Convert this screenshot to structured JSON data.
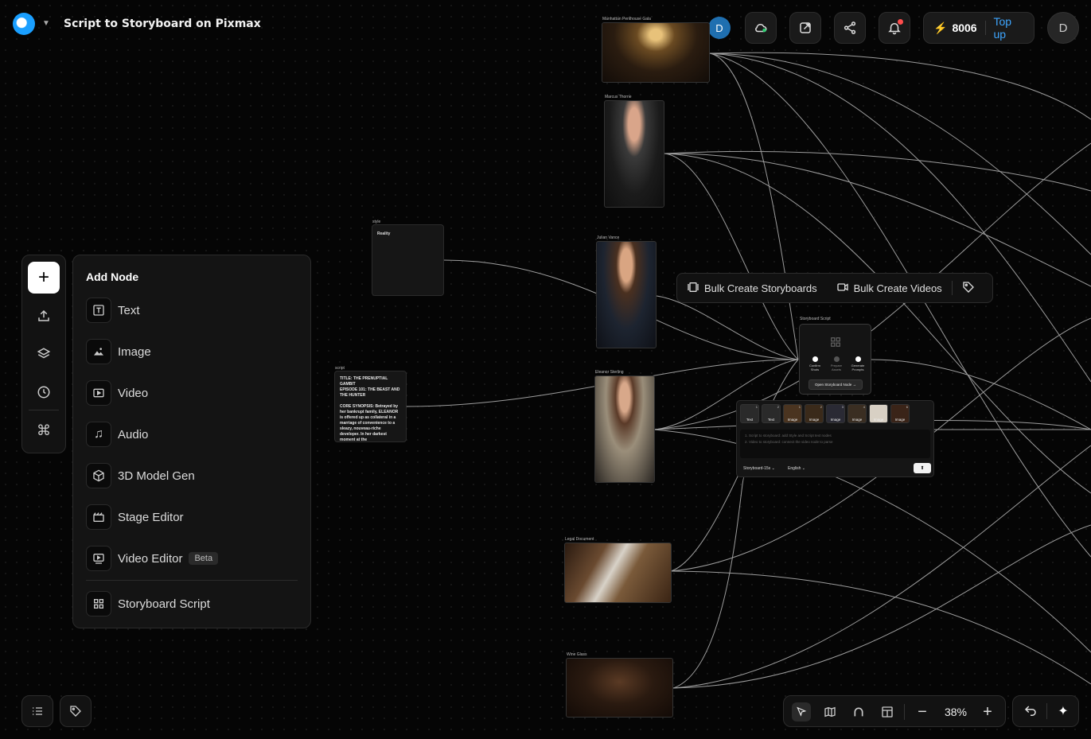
{
  "header": {
    "app_title": "Script to Storyboard on Pixmax",
    "collaborator_initial": "D",
    "credits": "8006",
    "top_up_label": "Top up",
    "user_initial": "D"
  },
  "add_node_panel": {
    "title": "Add Node",
    "items": [
      {
        "label": "Text",
        "icon": "text-icon"
      },
      {
        "label": "Image",
        "icon": "image-icon"
      },
      {
        "label": "Video",
        "icon": "video-icon"
      },
      {
        "label": "Audio",
        "icon": "audio-icon"
      },
      {
        "label": "3D Model Gen",
        "icon": "cube-icon"
      },
      {
        "label": "Stage Editor",
        "icon": "stage-icon"
      },
      {
        "label": "Video Editor",
        "icon": "video-editor-icon",
        "badge": "Beta"
      },
      {
        "label": "Storyboard Script",
        "icon": "grid-icon"
      }
    ]
  },
  "nodes": {
    "manhattan": "Manhattan Penthouse Gala",
    "marcus": "Marcus Thorne",
    "julian": "Julian Vance",
    "eleanor": "Eleanor Sterling",
    "legal": "Legal Document",
    "wine": "Wine Glass",
    "style_label": "style",
    "style_text": "Reality",
    "script_label": "script",
    "script_text": "TITLE: THE PRENUPTIAL GAMBIT\nEPISODE 101: THE BEAST AND THE HUNTER\n\nCORE SYNOPSIS: Betrayed by her bankrupt family, ELEANOR is offered up as collateral in a marriage of convenience to a sleazy, nouveau-riche developer. In her darkest moment at the",
    "storyboard_label": "Storyboard Script",
    "steps": [
      "Confirm Shots",
      "Prepare Assets",
      "Generate Prompts"
    ],
    "open_button": "Open Storyboard Node →",
    "thumb_labels": [
      "Text",
      "Text",
      "Image",
      "Image",
      "Image",
      "Image",
      "Image",
      "Image"
    ],
    "thumb_counts": [
      "1",
      "2",
      "1",
      "2",
      "3",
      "4",
      "5",
      "6"
    ],
    "instructions": "1. Script to storyboard: add Style and Script text nodes\n2. Video to storyboard: connect the video node to parse",
    "model": "Storyboard-15s",
    "language": "English"
  },
  "bulk_toolbar": {
    "storyboards": "Bulk Create Storyboards",
    "videos": "Bulk Create Videos"
  },
  "zoom": {
    "level": "38%"
  }
}
